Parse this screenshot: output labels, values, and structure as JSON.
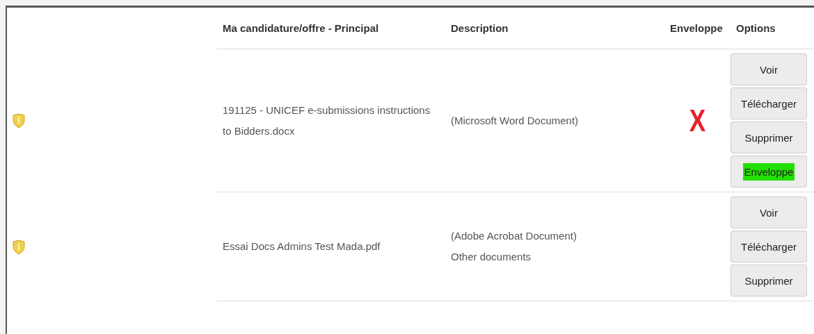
{
  "table": {
    "columns": [
      "Ma candidature/offre - Principal",
      "Description",
      "Enveloppe",
      "Options"
    ],
    "rows": [
      {
        "name": "191125 - UNICEF e-submissions instructions to Bidders.docx",
        "description": [
          "(Microsoft Word Document)"
        ],
        "envelope": "X",
        "buttons": [
          {
            "label": "Voir",
            "highlighted": false
          },
          {
            "label": "Télécharger",
            "highlighted": false
          },
          {
            "label": "Supprimer",
            "highlighted": false
          },
          {
            "label": "Enveloppe",
            "highlighted": true
          }
        ]
      },
      {
        "name": "Essai Docs Admins Test Mada.pdf",
        "description": [
          "(Adobe Acrobat Document)",
          "Other documents"
        ],
        "buttons": [
          {
            "label": "Voir",
            "highlighted": false
          },
          {
            "label": "Télécharger",
            "highlighted": false
          },
          {
            "label": "Supprimer",
            "highlighted": false
          }
        ]
      }
    ]
  }
}
